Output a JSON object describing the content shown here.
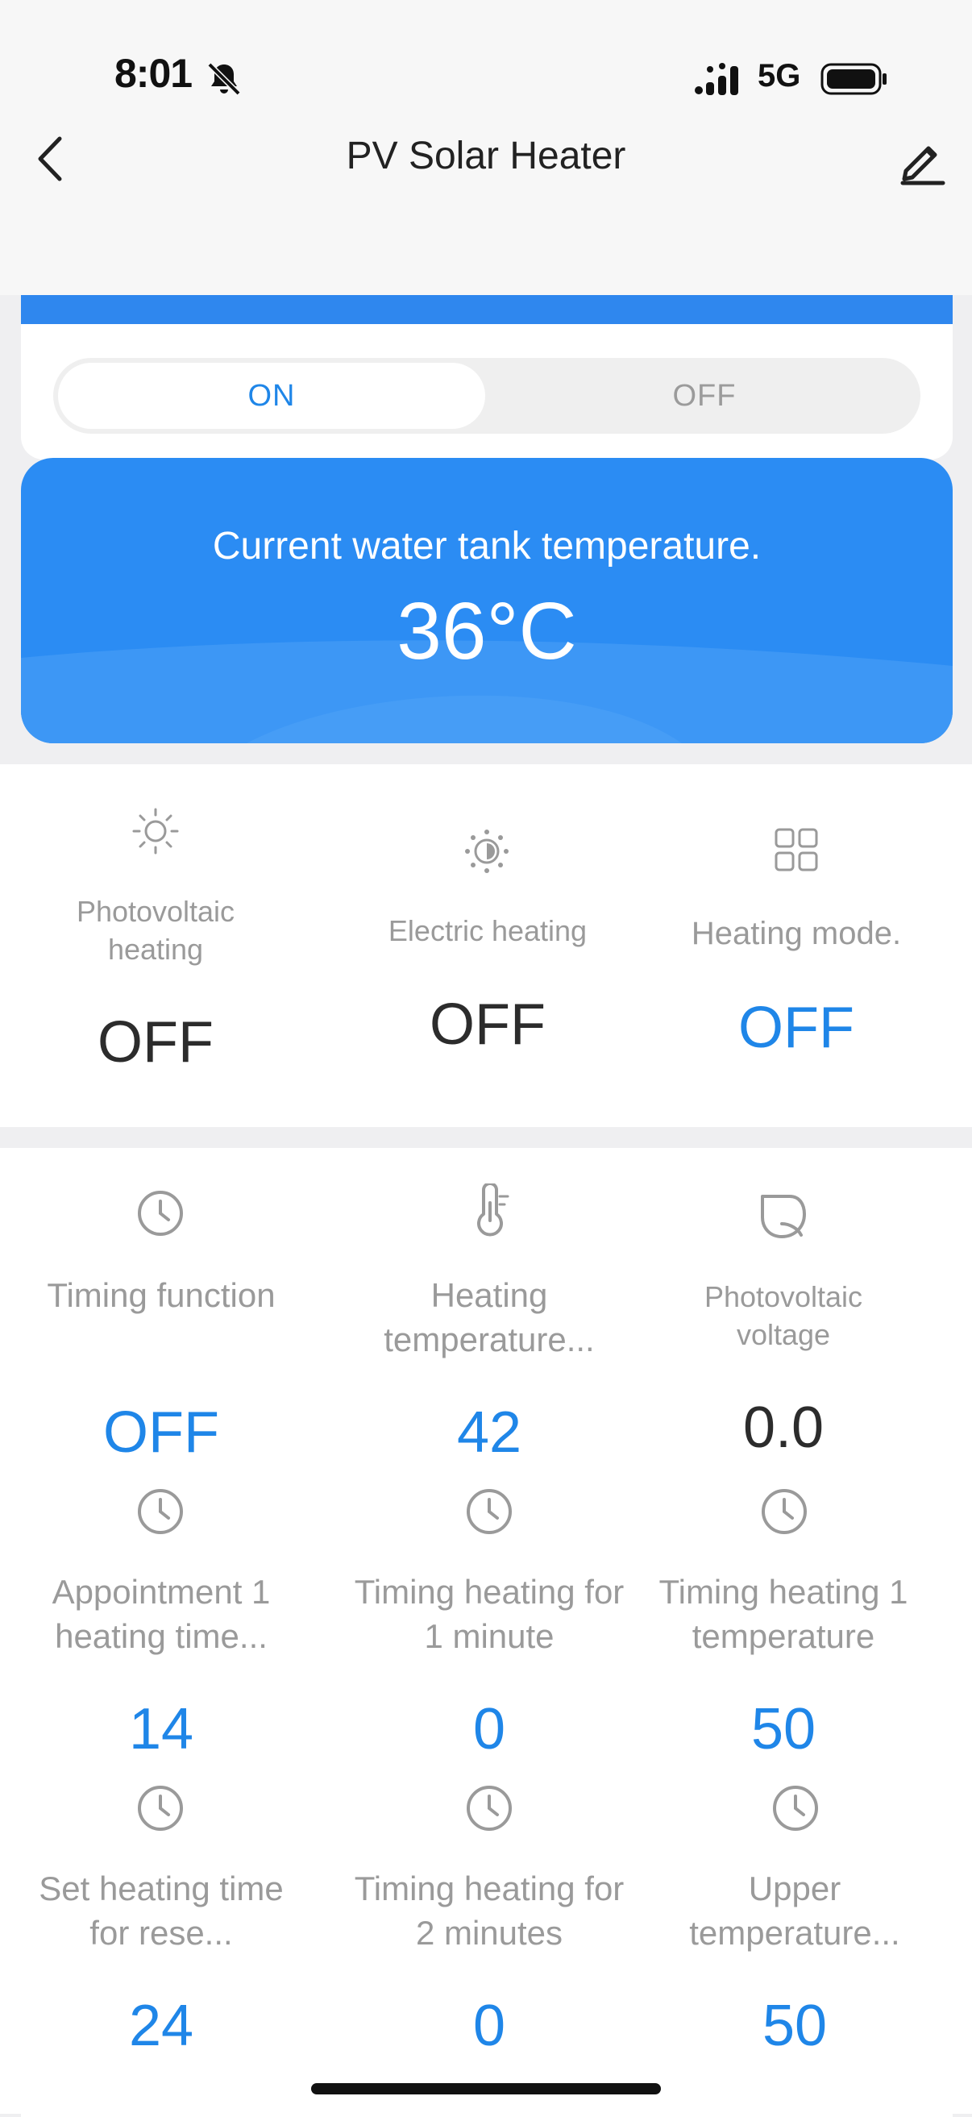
{
  "status_bar": {
    "time": "8:01",
    "network": "5G"
  },
  "header": {
    "title": "PV Solar Heater"
  },
  "power_toggle": {
    "on_label": "ON",
    "off_label": "OFF",
    "selected": "ON"
  },
  "tank": {
    "label": "Current water tank temperature.",
    "value": "36°C"
  },
  "status_items": [
    {
      "icon": "sun-icon",
      "label": "Photovoltaic heating",
      "value": "OFF"
    },
    {
      "icon": "brightness-icon",
      "label": "Electric heating",
      "value": "OFF"
    },
    {
      "icon": "grid-icon",
      "label": "Heating mode.",
      "value": "OFF"
    }
  ],
  "grid_items": [
    {
      "icon": "clock-icon",
      "label": "Timing function",
      "value": "OFF"
    },
    {
      "icon": "thermometer-icon",
      "label": "Heating temperature...",
      "value": "42"
    },
    {
      "icon": "leaf-icon",
      "label": "Photovoltaic voltage",
      "value": "0.0"
    },
    {
      "icon": "clock-icon",
      "label": "Appointment 1 heating time...",
      "value": "14"
    },
    {
      "icon": "clock-icon",
      "label": "Timing heating for 1 minute",
      "value": "0"
    },
    {
      "icon": "clock-icon",
      "label": "Timing heating 1 temperature",
      "value": "50"
    },
    {
      "icon": "clock-icon",
      "label": "Set heating time for rese...",
      "value": "24"
    },
    {
      "icon": "clock-icon",
      "label": "Timing heating for 2 minutes",
      "value": "0"
    },
    {
      "icon": "clock-icon",
      "label": "Upper temperature...",
      "value": "50"
    }
  ],
  "colors": {
    "accent": "#1f86e8",
    "card_blue": "#2b8cf3"
  }
}
